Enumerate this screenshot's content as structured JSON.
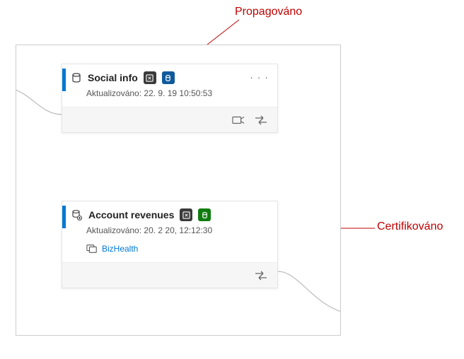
{
  "annotations": {
    "promoted": "Propagováno",
    "certified": "Certifikováno"
  },
  "cards": [
    {
      "title": "Social info",
      "updated_prefix": "Aktualizováno:",
      "updated_value": "22. 9. 19 10:50:53",
      "endorsement": "promoted",
      "endorsement_icon": "promoted-icon",
      "type_icon": "dataset-icon",
      "tagged": true,
      "show_ellipsis": true,
      "link": null,
      "footer_icons": [
        "share-icon",
        "lineage-icon"
      ]
    },
    {
      "title": "Account revenues",
      "updated_prefix": "Aktualizováno:",
      "updated_value": "20. 2 20, 12:12:30",
      "endorsement": "certified",
      "endorsement_icon": "certified-icon",
      "type_icon": "dataset-shared-icon",
      "tagged": true,
      "show_ellipsis": false,
      "link": {
        "label": "BizHealth",
        "icon": "workspace-icon"
      },
      "footer_icons": [
        "lineage-icon"
      ]
    }
  ],
  "colors": {
    "accent": "#0078d4",
    "promoted_badge": "#0f5a9c",
    "certified_badge": "#107c10",
    "tag_badge": "#3a3a3a",
    "annotation": "#c00000"
  }
}
